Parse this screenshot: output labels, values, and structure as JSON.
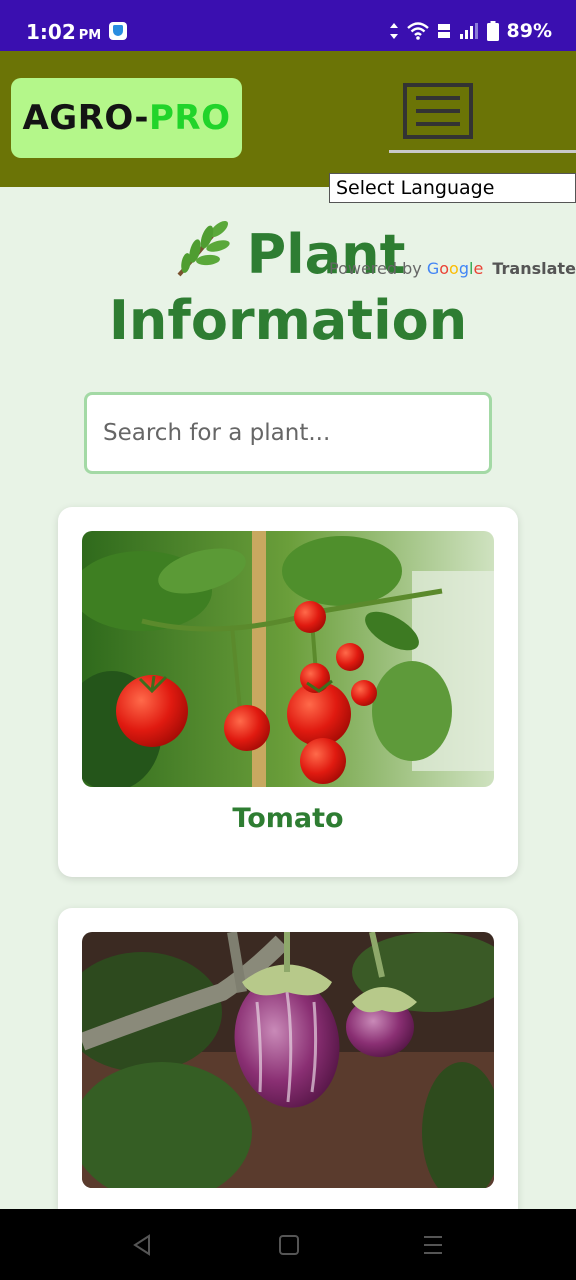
{
  "status_bar": {
    "time": "1:02",
    "ampm": "PM",
    "battery": "89%",
    "icons": [
      "shield-icon",
      "data-arrows-icon",
      "wifi-icon",
      "volte-icon",
      "signal-icon",
      "battery-icon"
    ]
  },
  "header": {
    "logo_part1": "AGRO-",
    "logo_part2": "PRO",
    "menu_icon": "hamburger-menu-icon"
  },
  "translate": {
    "select_label": "Select Language",
    "powered_by": "Powered by",
    "google": [
      "G",
      "o",
      "o",
      "g",
      "l",
      "e"
    ],
    "translate_label": "Translate"
  },
  "page": {
    "title_icon": "leaf-icon",
    "title": "Plant Information"
  },
  "search": {
    "placeholder": "Search for a plant..."
  },
  "plants": [
    {
      "name": "Tomato",
      "image": "tomato-plant-photo"
    },
    {
      "name": "",
      "image": "eggplant-plant-photo"
    }
  ],
  "nav": {
    "buttons": [
      "back-icon",
      "home-icon",
      "recents-icon"
    ]
  },
  "colors": {
    "status_bar": "#3a0fb0",
    "header": "#6b7406",
    "logo_bg": "#b4f78a",
    "logo_accent": "#21d42a",
    "page_bg": "#e8f3e6",
    "title": "#2e7d32",
    "search_border": "#a3d9a5"
  }
}
